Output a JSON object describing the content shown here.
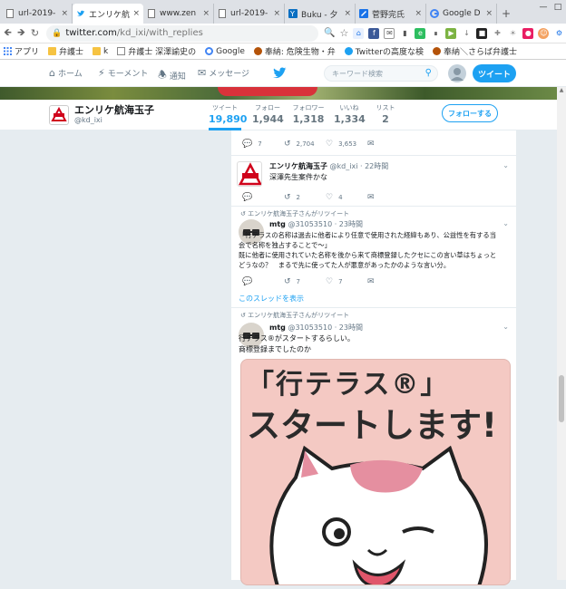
{
  "browser": {
    "tabs": [
      {
        "title": "url-2019-",
        "active": false,
        "icon": "page-icon"
      },
      {
        "title": "エンリケ航",
        "active": true,
        "icon": "twitter-icon"
      },
      {
        "title": "www.zen",
        "active": false,
        "icon": "page-icon"
      },
      {
        "title": "url-2019-",
        "active": false,
        "icon": "page-icon"
      },
      {
        "title": "Buku - 夕",
        "active": false,
        "icon": "buku-icon"
      },
      {
        "title": "菅野完氏",
        "active": false,
        "icon": "tab-icon"
      },
      {
        "title": "Google D",
        "active": false,
        "icon": "google-icon"
      }
    ],
    "close_glyph": "×",
    "newtab_glyph": "+",
    "url_host": "twitter.com",
    "url_path": "/kd_ixi/with_replies",
    "bookmarks": [
      {
        "label": "アプリ",
        "icon": "apps-icon"
      },
      {
        "label": "弁護士",
        "icon": "folder-icon"
      },
      {
        "label": "k",
        "icon": "folder-icon"
      },
      {
        "label": "弁護士 深澤諭史の",
        "icon": "page-icon"
      },
      {
        "label": "Google",
        "icon": "google-icon"
      },
      {
        "label": "奉納: 危険生物・弁",
        "icon": "page-icon"
      },
      {
        "label": "Twitterの高度な検",
        "icon": "twitter-icon"
      },
      {
        "label": "奉納＼さらば弁護士",
        "icon": "page-icon"
      }
    ]
  },
  "twitter_nav": {
    "home": "ホーム",
    "moments": "モーメント",
    "notifications": "通知",
    "messages": "メッセージ",
    "search_placeholder": "キーワード検索",
    "tweet_button": "ツイート"
  },
  "profile": {
    "name": "エンリケ航海玉子",
    "handle": "@kd_ixi",
    "stats": [
      {
        "label": "ツイート",
        "value": "19,890",
        "active": true
      },
      {
        "label": "フォロー",
        "value": "1,944",
        "active": false
      },
      {
        "label": "フォロワー",
        "value": "1,318",
        "active": false
      },
      {
        "label": "いいね",
        "value": "1,334",
        "active": false
      },
      {
        "label": "リスト",
        "value": "2",
        "active": false
      }
    ],
    "follow_button": "フォローする"
  },
  "timeline": {
    "tweet0": {
      "replies": "7",
      "retweets": "2,704",
      "likes": "3,653"
    },
    "tweet1": {
      "name": "エンリケ航海玉子",
      "handle": "@kd_ixi",
      "time": "22時間",
      "text": "深澤先生案件かな",
      "replies": "",
      "retweets": "2",
      "likes": "4"
    },
    "tweet2": {
      "retweet_note": "エンリケ航海玉子さんがリツイート",
      "name": "mtg",
      "handle": "@31053510",
      "time": "23時間",
      "lines": [
        "「行テラスの名称は過去に他者により任意で使用された経緯もあり、公益性を有する当",
        "会で名称を独占することで～」",
        "既に他者に使用されていた名称を後から来て商標登録したクセにこの言い草はちょっと",
        "どうなの？　まるで先に使ってた人が悪意があったかのような言い分。"
      ],
      "replies": "",
      "retweets": "7",
      "likes": "7",
      "thread_link": "このスレッドを表示"
    },
    "tweet3": {
      "retweet_note": "エンリケ航海玉子さんがリツイート",
      "name": "mtg",
      "handle": "@31053510",
      "time": "23時間",
      "lines": [
        "行テラス®がスタートするらしい。",
        "商標登録までしたのか"
      ],
      "image_line1": "「行テラス®」",
      "image_line2": "スタートします!"
    }
  },
  "colors": {
    "twitter_blue": "#1da1f2",
    "background": "#e6ecf0"
  }
}
